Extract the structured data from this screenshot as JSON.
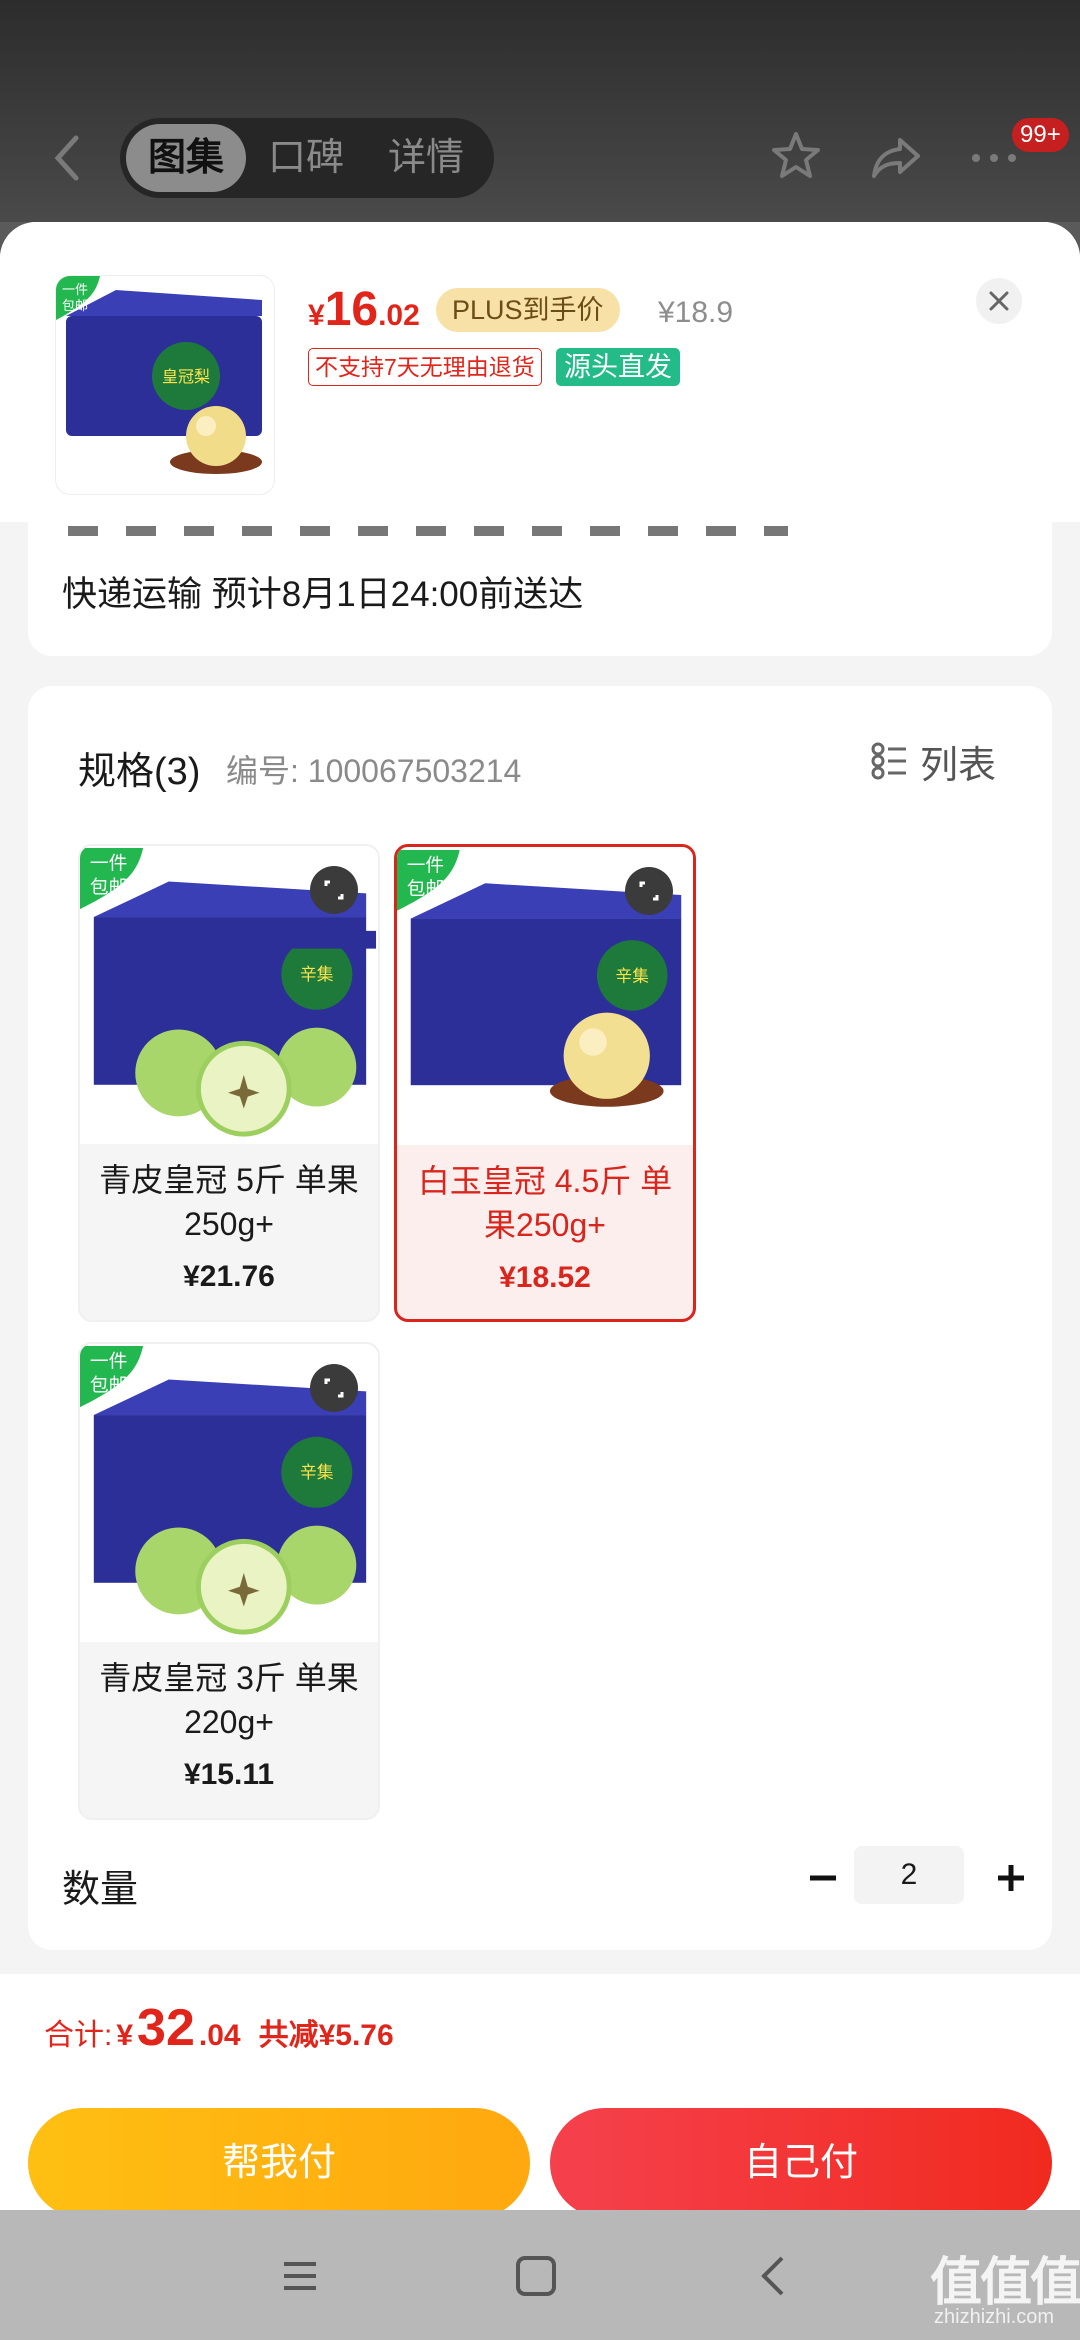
{
  "header": {
    "tabs": [
      {
        "label": "图集",
        "active": true
      },
      {
        "label": "口碑",
        "active": false
      },
      {
        "label": "详情",
        "active": false
      }
    ],
    "badge_count": "99+",
    "icons": [
      "back-icon",
      "star-icon",
      "share-icon",
      "more-icon"
    ]
  },
  "product": {
    "free_ship_tag": [
      "一件",
      "包邮"
    ],
    "price_symbol": "¥",
    "price_int": "16",
    "price_dec": ".02",
    "plus_tag": "PLUS到手价",
    "original_price": "¥18.9",
    "return_tag": "不支持7天无理由退货",
    "source_tag": "源头直发"
  },
  "shipping": {
    "text": "快递运输 预计8月1日24:00前送达"
  },
  "spec": {
    "title": "规格(3)",
    "code": "编号: 100067503214",
    "list_label": "列表",
    "options": [
      {
        "name": "青皮皇冠 5斤 单果250g+",
        "price": "¥21.76",
        "fruit": "green",
        "selected": false
      },
      {
        "name": "白玉皇冠 4.5斤 单果250g+",
        "price": "¥18.52",
        "fruit": "yellow",
        "selected": true
      },
      {
        "name": "青皮皇冠 3斤 单果220g+",
        "price": "¥15.11",
        "fruit": "green",
        "selected": false
      }
    ]
  },
  "quantity": {
    "label": "数量",
    "value": "2"
  },
  "summary": {
    "label": "合计:",
    "symbol": "¥",
    "total_int": "32",
    "total_dec": ".04",
    "saving": "共减¥5.76"
  },
  "actions": {
    "help_pay": "帮我付",
    "self_pay": "自己付"
  },
  "watermark": {
    "logo": "值值值",
    "site": "zhizhizhi.com"
  },
  "colors": {
    "accent_red": "#e1251b",
    "plus_gold": "#f7e1a6",
    "source_green": "#23bb87",
    "help_btn": "#ffb312",
    "self_btn": "#f3343a"
  }
}
